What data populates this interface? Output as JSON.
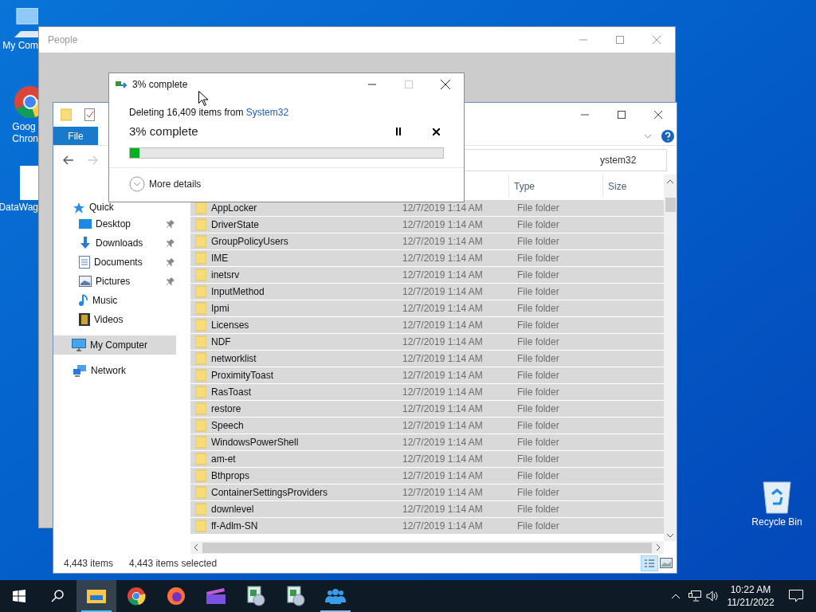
{
  "desktop_icons": [
    {
      "kind": "computer",
      "lines": [
        "My Com"
      ]
    },
    {
      "kind": "chrome",
      "lines": [
        "Goog",
        "Chron"
      ]
    },
    {
      "kind": "file",
      "lines": [
        "DataWag"
      ]
    },
    {
      "kind": "recycle",
      "lines": [
        "Recycle Bin"
      ]
    }
  ],
  "people_window": {
    "title": "People"
  },
  "explorer": {
    "ribbon_tabs": [
      "File"
    ],
    "address": "ystem32",
    "columns": [
      "Type",
      "Size"
    ],
    "nav": [
      {
        "kind": "star",
        "label": "Quick",
        "pinned": false,
        "selected": false
      },
      {
        "kind": "desktop",
        "label": "Desktop",
        "pinned": true,
        "selected": false
      },
      {
        "kind": "downloads",
        "label": "Downloads",
        "pinned": true,
        "selected": false
      },
      {
        "kind": "documents",
        "label": "Documents",
        "pinned": true,
        "selected": false
      },
      {
        "kind": "pictures",
        "label": "Pictures",
        "pinned": true,
        "selected": false
      },
      {
        "kind": "music",
        "label": "Music",
        "pinned": false,
        "selected": false
      },
      {
        "kind": "videos",
        "label": "Videos",
        "pinned": false,
        "selected": false
      },
      {
        "kind": "computer",
        "label": "My Computer",
        "pinned": false,
        "selected": true
      },
      {
        "kind": "network",
        "label": "Network",
        "pinned": false,
        "selected": false
      }
    ],
    "rows": [
      {
        "name": "AppLocker",
        "date": "12/7/2019 1:14 AM",
        "type": "File folder",
        "selected": true
      },
      {
        "name": "DriverState",
        "date": "12/7/2019 1:14 AM",
        "type": "File folder",
        "selected": true
      },
      {
        "name": "GroupPolicyUsers",
        "date": "12/7/2019 1:14 AM",
        "type": "File folder",
        "selected": true
      },
      {
        "name": "IME",
        "date": "12/7/2019 1:14 AM",
        "type": "File folder",
        "selected": true
      },
      {
        "name": "inetsrv",
        "date": "12/7/2019 1:14 AM",
        "type": "File folder",
        "selected": true
      },
      {
        "name": "InputMethod",
        "date": "12/7/2019 1:14 AM",
        "type": "File folder",
        "selected": true
      },
      {
        "name": "Ipmi",
        "date": "12/7/2019 1:14 AM",
        "type": "File folder",
        "selected": true
      },
      {
        "name": "Licenses",
        "date": "12/7/2019 1:14 AM",
        "type": "File folder",
        "selected": true
      },
      {
        "name": "NDF",
        "date": "12/7/2019 1:14 AM",
        "type": "File folder",
        "selected": true
      },
      {
        "name": "networklist",
        "date": "12/7/2019 1:14 AM",
        "type": "File folder",
        "selected": true
      },
      {
        "name": "ProximityToast",
        "date": "12/7/2019 1:14 AM",
        "type": "File folder",
        "selected": true
      },
      {
        "name": "RasToast",
        "date": "12/7/2019 1:14 AM",
        "type": "File folder",
        "selected": true
      },
      {
        "name": "restore",
        "date": "12/7/2019 1:14 AM",
        "type": "File folder",
        "selected": true
      },
      {
        "name": "Speech",
        "date": "12/7/2019 1:14 AM",
        "type": "File folder",
        "selected": true
      },
      {
        "name": "WindowsPowerShell",
        "date": "12/7/2019 1:14 AM",
        "type": "File folder",
        "selected": true
      },
      {
        "name": "am-et",
        "date": "12/7/2019 1:14 AM",
        "type": "File folder",
        "selected": true
      },
      {
        "name": "Bthprops",
        "date": "12/7/2019 1:14 AM",
        "type": "File folder",
        "selected": true
      },
      {
        "name": "ContainerSettingsProviders",
        "date": "12/7/2019 1:14 AM",
        "type": "File folder",
        "selected": true
      },
      {
        "name": "downlevel",
        "date": "12/7/2019 1:14 AM",
        "type": "File folder",
        "selected": true
      },
      {
        "name": "ff-Adlm-SN",
        "date": "12/7/2019 1:14 AM",
        "type": "File folder",
        "selected": true
      }
    ],
    "status": [
      "4,443 items",
      "4,443 items selected"
    ]
  },
  "dialog": {
    "title": "3% complete",
    "message": "Deleting 16,409 items from ",
    "source_link": "System32",
    "heading": "3% complete",
    "level": 0.03,
    "more_details": "More details"
  },
  "taskbar": {
    "items": [
      {
        "kind": "start",
        "active": false
      },
      {
        "kind": "search",
        "active": false
      },
      {
        "kind": "explorer",
        "active": true
      },
      {
        "kind": "chrome",
        "active": false
      },
      {
        "kind": "firefox",
        "active": false
      },
      {
        "kind": "clapper",
        "active": false
      },
      {
        "kind": "app",
        "active": false
      },
      {
        "kind": "app",
        "active": false
      },
      {
        "kind": "people",
        "active": true
      }
    ],
    "time": "10:22 AM",
    "date": "11/21/2022"
  }
}
